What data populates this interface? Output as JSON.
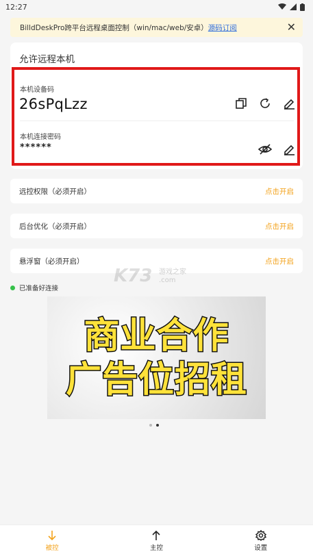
{
  "status_bar": {
    "time": "12:27"
  },
  "banner": {
    "text": "BilldDeskPro跨平台远程桌面控制（win/mac/web/安卓）",
    "link": "源码订阅",
    "close": "✕"
  },
  "card": {
    "title": "允许远程本机",
    "device_code_label": "本机设备码",
    "device_code": "26sPqLzz",
    "password_label": "本机连接密码",
    "password": "******"
  },
  "rows": [
    {
      "label": "远控权限（必须开启）",
      "action": "点击开启"
    },
    {
      "label": "后台优化（必须开启）",
      "action": "点击开启"
    },
    {
      "label": "悬浮窗（必须开启）",
      "action": "点击开启"
    }
  ],
  "ready_text": "已准备好连接",
  "ad": {
    "line1": "商业合作",
    "line2": "广告位招租"
  },
  "watermark": {
    "main": "K73",
    "sub1": "游戏之家",
    "sub2": ".com"
  },
  "bottom_nav": [
    {
      "label": "被控",
      "icon": "arrow-down-icon",
      "active": true
    },
    {
      "label": "主控",
      "icon": "arrow-up-icon",
      "active": false
    },
    {
      "label": "设置",
      "icon": "gear-icon",
      "active": false
    }
  ],
  "colors": {
    "accent": "#f3a21b",
    "highlight": "#e01919",
    "link": "#2f6ddb",
    "banner_bg": "#fdf6dc"
  }
}
